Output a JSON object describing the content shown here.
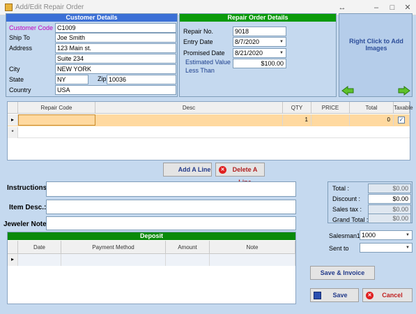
{
  "window": {
    "title": "Add/Edit Repair Order"
  },
  "customer": {
    "header": "Customer Details",
    "code_label": "Customer Code",
    "code": "C1009",
    "shipto_label": "Ship To",
    "shipto": "Joe Smith",
    "address_label": "Address",
    "address1": "123 Main st.",
    "address2": "Suite 234",
    "city_label": "City",
    "city": "NEW YORK",
    "state_label": "State",
    "state": "NY",
    "zip_label": "Zip",
    "zip": "10036",
    "country_label": "Country",
    "country": "USA"
  },
  "order": {
    "header": "Repair Order Details",
    "repair_no_label": "Repair No.",
    "repair_no": "9018",
    "entry_label": "Entry Date",
    "entry": "8/7/2020",
    "promised_label": "Promised  Date",
    "promised": "8/21/2020",
    "est_label1": "Estimated Value",
    "est_label2": "Less Than",
    "est": "$100.00"
  },
  "images": {
    "hint": "Right Click to Add Images"
  },
  "lines": {
    "columns": [
      "Repair Code",
      "Desc",
      "QTY",
      "PRICE",
      "Total",
      "Taxable"
    ],
    "row": {
      "code": "",
      "desc": "",
      "qty": "1",
      "price": "",
      "total": "0",
      "taxable": true
    },
    "new_row_marker": "*",
    "add_label": "Add A Line",
    "delete_label": "Delete A Line"
  },
  "notes": {
    "instructions_label": "Instructions:",
    "item_label": "Item Desc.:",
    "jeweler_label": "Jeweler Note:"
  },
  "deposit": {
    "header": "Deposit",
    "columns": [
      "Date",
      "Payment Method",
      "Amount",
      "Note"
    ]
  },
  "totals": {
    "total_label": "Total :",
    "total": "$0.00",
    "discount_label": "Discount :",
    "discount": "$0.00",
    "salestax_label": "Sales tax :",
    "salestax": "$0.00",
    "grand_label": "Grand Total :",
    "grand": "$0.00"
  },
  "salesman": {
    "label": "Salesman1",
    "value": "1000"
  },
  "sentto": {
    "label": "Sent to",
    "value": ""
  },
  "buttons": {
    "save_invoice": "Save & Invoice",
    "save": "Save",
    "cancel": "Cancel"
  },
  "colors": {
    "customer_header": "#3b6fd6",
    "order_header": "#0a9a0a",
    "deposit_header": "#0a8a0a",
    "selected_row": "#ffd9a0"
  }
}
